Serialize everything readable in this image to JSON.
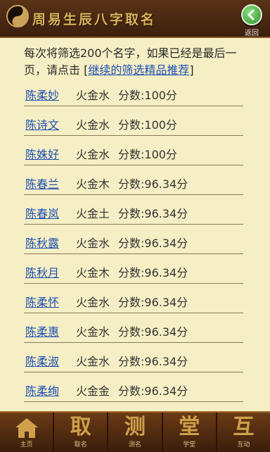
{
  "header": {
    "title": "周易生辰八字取名",
    "back_label": "返回"
  },
  "intro": {
    "text": "每次将筛选200个名字，如果已经是最后一页，请点击 [",
    "link": "继续的筛选精品推荐",
    "close": "]"
  },
  "results": [
    {
      "name": "陈柔妙",
      "wuxing": "火金水",
      "score_label": "分数:",
      "score": "100分"
    },
    {
      "name": "陈诗文",
      "wuxing": "火金水",
      "score_label": "分数:",
      "score": "100分"
    },
    {
      "name": "陈姝好",
      "wuxing": "火金水",
      "score_label": "分数:",
      "score": "100分"
    },
    {
      "name": "陈春兰",
      "wuxing": "火金木",
      "score_label": "分数:",
      "score": "96.34分"
    },
    {
      "name": "陈春岚",
      "wuxing": "火金土",
      "score_label": "分数:",
      "score": "96.34分"
    },
    {
      "name": "陈秋露",
      "wuxing": "火金水",
      "score_label": "分数:",
      "score": "96.34分"
    },
    {
      "name": "陈秋月",
      "wuxing": "火金木",
      "score_label": "分数:",
      "score": "96.34分"
    },
    {
      "name": "陈柔怀",
      "wuxing": "火金水",
      "score_label": "分数:",
      "score": "96.34分"
    },
    {
      "name": "陈柔惠",
      "wuxing": "火金水",
      "score_label": "分数:",
      "score": "96.34分"
    },
    {
      "name": "陈柔淑",
      "wuxing": "火金水",
      "score_label": "分数:",
      "score": "96.34分"
    },
    {
      "name": "陈柔绚",
      "wuxing": "火金金",
      "score_label": "分数:",
      "score": "96.34分"
    }
  ],
  "nav": [
    {
      "glyph": "",
      "label": "主页",
      "icon": "home-icon"
    },
    {
      "glyph": "取",
      "label": "取名"
    },
    {
      "glyph": "测",
      "label": "测名"
    },
    {
      "glyph": "堂",
      "label": "学堂"
    },
    {
      "glyph": "互",
      "label": "互动"
    }
  ]
}
